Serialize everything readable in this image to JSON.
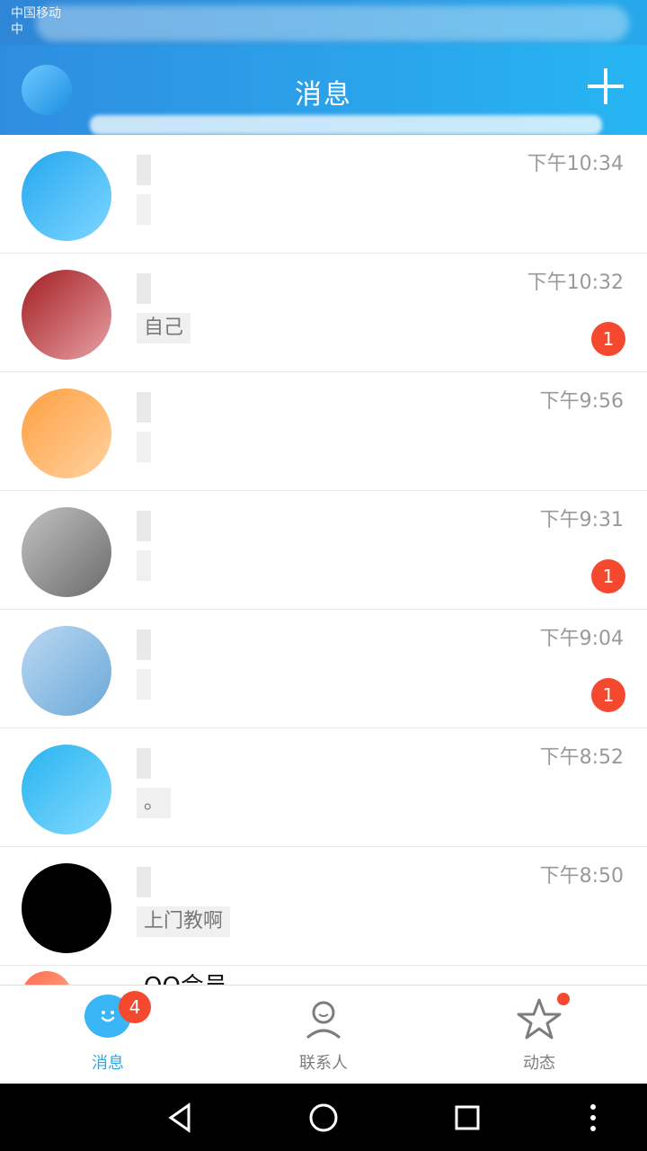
{
  "status_bar": {
    "line1": "中国移动",
    "line2": "中"
  },
  "top_bar": {
    "title": "消息",
    "plus_icon": "plus-icon"
  },
  "chats": [
    {
      "time": "下午10:34",
      "badge": "",
      "name": "",
      "preview": ""
    },
    {
      "time": "下午10:32",
      "badge": "1",
      "name": "",
      "preview": "自己"
    },
    {
      "time": "下午9:56",
      "badge": "",
      "name": "",
      "preview": ""
    },
    {
      "time": "下午9:31",
      "badge": "1",
      "name": "",
      "preview": ""
    },
    {
      "time": "下午9:04",
      "badge": "1",
      "name": "",
      "preview": ""
    },
    {
      "time": "下午8:52",
      "badge": "",
      "name": "",
      "preview": "。"
    },
    {
      "time": "下午8:50",
      "badge": "",
      "name": "",
      "preview": "上门教啊"
    },
    {
      "time": "",
      "badge": "",
      "name": "QQ会员",
      "preview": ""
    }
  ],
  "tabs": [
    {
      "label": "消息",
      "badge": "4",
      "active": true,
      "icon": "message-icon"
    },
    {
      "label": "联系人",
      "badge": "",
      "active": false,
      "icon": "contacts-icon"
    },
    {
      "label": "动态",
      "badge": "",
      "active": false,
      "icon": "star-icon"
    }
  ],
  "colors": {
    "accent": "#28A8EA",
    "badge": "#F5492F",
    "inactive": "#7D7D7D"
  }
}
